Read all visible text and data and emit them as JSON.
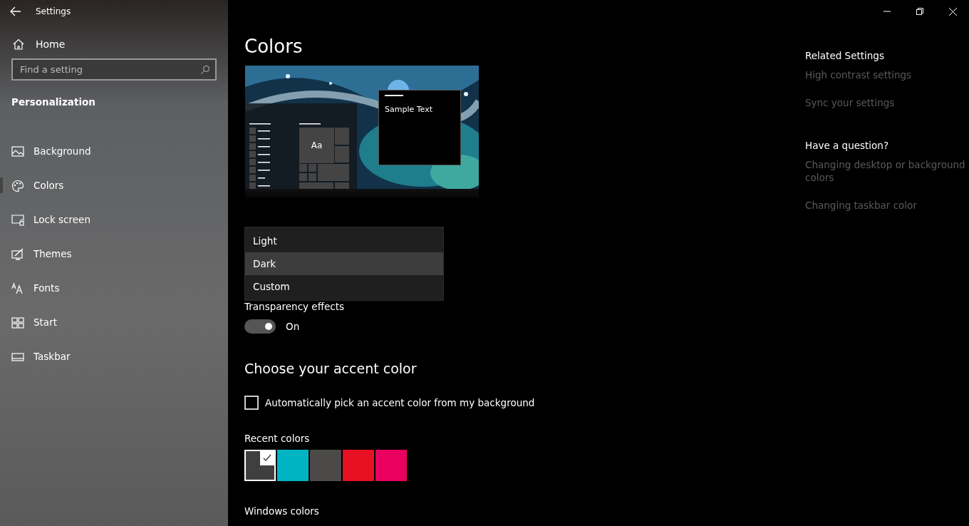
{
  "window": {
    "title": "Settings"
  },
  "sidebar": {
    "home": "Home",
    "search": {
      "placeholder": "Find a setting"
    },
    "section": "Personalization",
    "items": [
      {
        "label": "Background",
        "kind": "background",
        "selected": false
      },
      {
        "label": "Colors",
        "kind": "colors",
        "selected": true
      },
      {
        "label": "Lock screen",
        "kind": "lock",
        "selected": false
      },
      {
        "label": "Themes",
        "kind": "themes",
        "selected": false
      },
      {
        "label": "Fonts",
        "kind": "fonts",
        "selected": false
      },
      {
        "label": "Start",
        "kind": "start",
        "selected": false
      },
      {
        "label": "Taskbar",
        "kind": "taskbar",
        "selected": false
      }
    ]
  },
  "page": {
    "title": "Colors",
    "preview": {
      "tile_text": "Aa",
      "sample_text": "Sample Text"
    },
    "mode_menu": {
      "options": [
        {
          "label": "Light",
          "selected": false
        },
        {
          "label": "Dark",
          "selected": true
        },
        {
          "label": "Custom",
          "selected": false
        }
      ]
    },
    "transparency": {
      "label": "Transparency effects",
      "on": true,
      "state_text": "On"
    },
    "accent": {
      "heading": "Choose your accent color",
      "auto_pick": {
        "label": "Automatically pick an accent color from my background",
        "checked": false
      },
      "recent_label": "Recent colors",
      "recent_colors": [
        {
          "color": "#3f3f3f",
          "selected": true
        },
        {
          "color": "#00b4c4",
          "selected": false
        },
        {
          "color": "#4c4a48",
          "selected": false
        },
        {
          "color": "#e81123",
          "selected": false
        },
        {
          "color": "#ea005e",
          "selected": false
        }
      ],
      "windows_label": "Windows colors"
    }
  },
  "related": {
    "sections": [
      {
        "heading": "Related Settings",
        "links": [
          "High contrast settings",
          "Sync your settings"
        ]
      },
      {
        "heading": "Have a question?",
        "links": [
          "Changing desktop or background colors",
          "Changing taskbar color"
        ]
      }
    ]
  }
}
